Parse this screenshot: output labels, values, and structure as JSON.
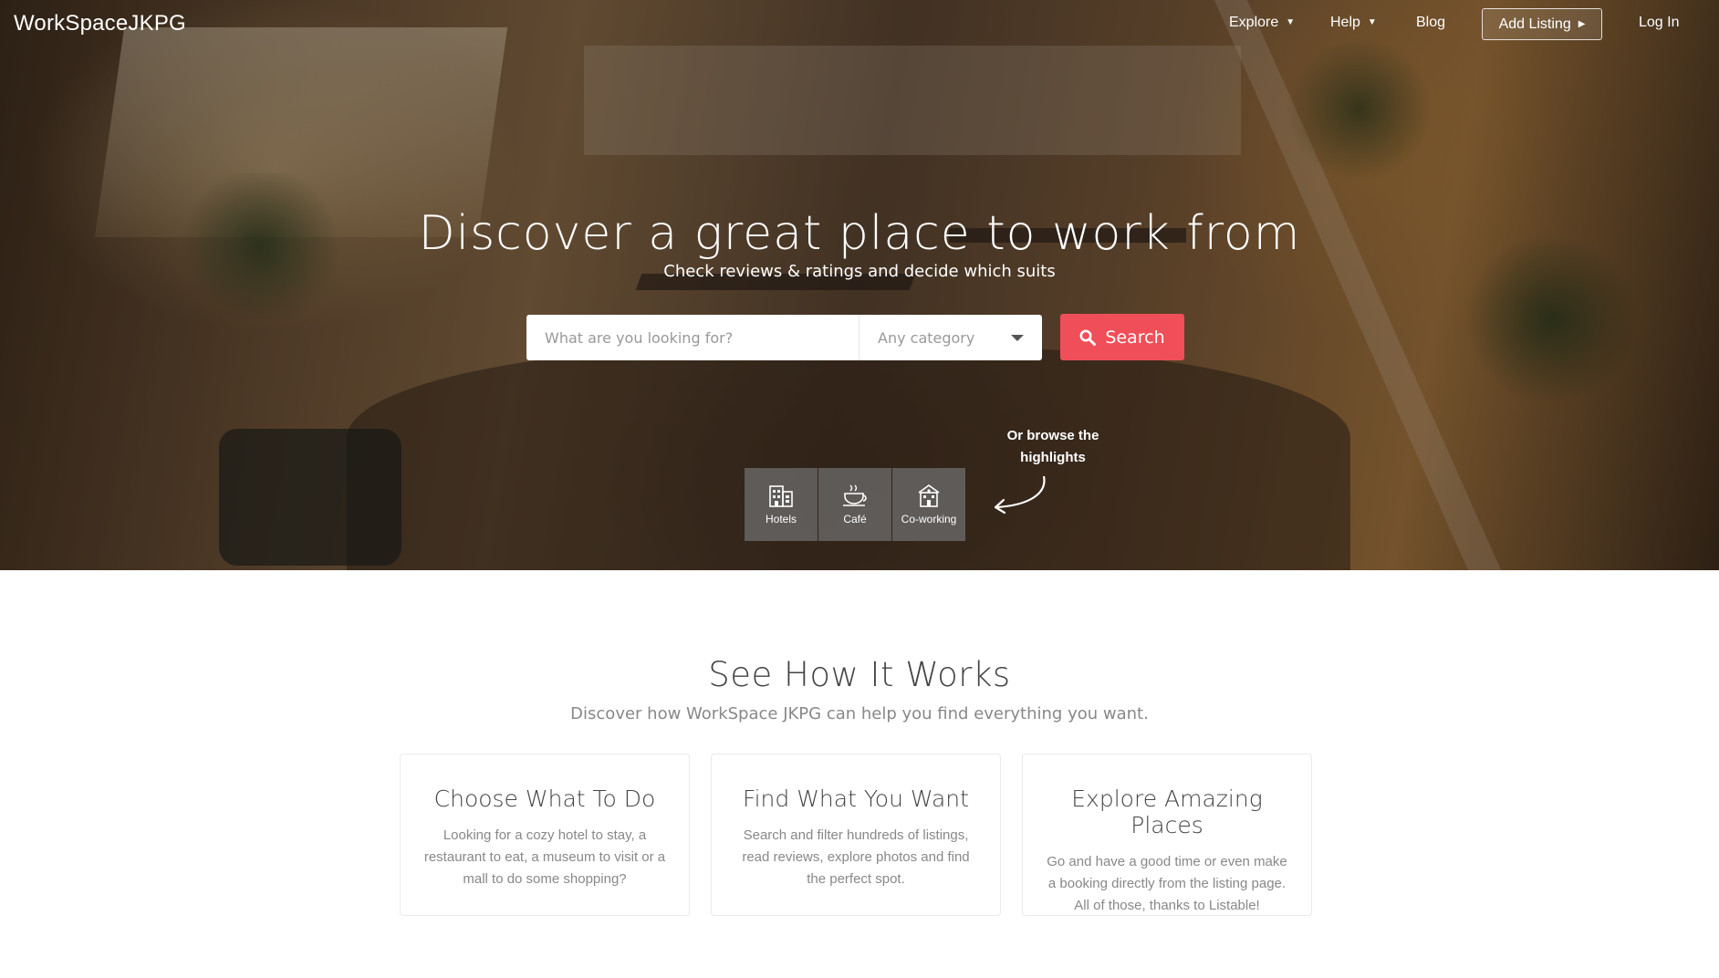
{
  "nav": {
    "logo": "WorkSpaceJKPG",
    "explore": "Explore",
    "help": "Help",
    "blog": "Blog",
    "add_listing": "Add Listing",
    "login": "Log In"
  },
  "hero": {
    "title": "Discover a great place to work from",
    "subtitle": "Check reviews & ratings and decide which suits",
    "search_placeholder": "What are you looking for?",
    "category_value": "Any category",
    "search_button": "Search",
    "browse_note": "Or browse the highlights",
    "categories": [
      {
        "label": "Hotels",
        "icon": "building-icon"
      },
      {
        "label": "Café",
        "icon": "coffee-cup-icon"
      },
      {
        "label": "Co-working",
        "icon": "office-building-icon"
      }
    ]
  },
  "how": {
    "title": "See How It Works",
    "subtitle": "Discover how WorkSpace JKPG can help you find everything you want.",
    "cards": [
      {
        "title": "Choose What To Do",
        "text": "Looking for a cozy hotel to stay, a restaurant to eat, a museum to visit or a mall to do some shopping?"
      },
      {
        "title": "Find What You Want",
        "text": "Search and filter hundreds of listings, read reviews, explore photos and find the perfect spot."
      },
      {
        "title": "Explore Amazing Places",
        "text": "Go and have a good time or even make a booking directly from the listing page. All of those, thanks to Listable!"
      }
    ]
  },
  "colors": {
    "accent": "#f04e58",
    "hero_overlay": "#2a1d14"
  }
}
